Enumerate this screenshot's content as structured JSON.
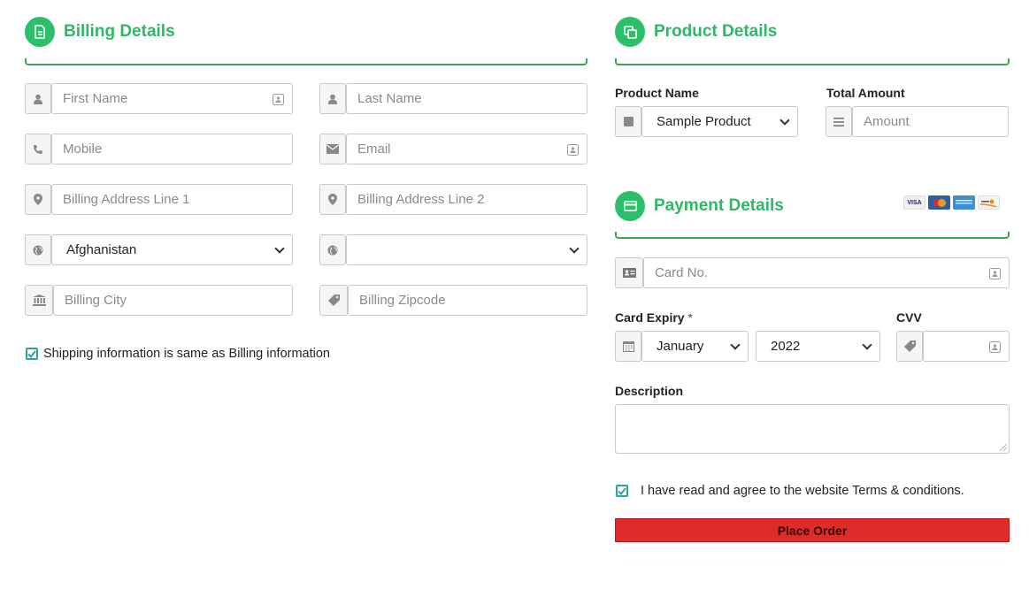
{
  "billing": {
    "title": "Billing Details",
    "first_name_placeholder": "First Name",
    "last_name_placeholder": "Last Name",
    "mobile_placeholder": "Mobile",
    "email_placeholder": "Email",
    "address1_placeholder": "Billing Address Line 1",
    "address2_placeholder": "Billing Address Line 2",
    "country_value": "Afghanistan",
    "state_value": "",
    "city_placeholder": "Billing City",
    "zip_placeholder": "Billing Zipcode",
    "same_shipping_label": "Shipping information is same as Billing information",
    "same_shipping_checked": true
  },
  "product": {
    "title": "Product Details",
    "name_label": "Product Name",
    "name_value": "Sample Product",
    "amount_label": "Total Amount",
    "amount_placeholder": "Amount"
  },
  "payment": {
    "title": "Payment Details",
    "card_logos": [
      "VISA",
      "MasterCard",
      "AMEX",
      "DISCOVER"
    ],
    "card_no_placeholder": "Card No.",
    "expiry_label": "Card Expiry",
    "expiry_required_mark": "*",
    "expiry_month": "January",
    "expiry_year": "2022",
    "cvv_label": "CVV",
    "description_label": "Description",
    "terms_label": "I have read and agree to the website Terms & conditions.",
    "terms_checked": true,
    "place_order_label": "Place Order"
  },
  "colors": {
    "accent_green": "#2eb865",
    "button_red": "#e02b2b",
    "checkbox_teal": "#2aa3a3"
  }
}
